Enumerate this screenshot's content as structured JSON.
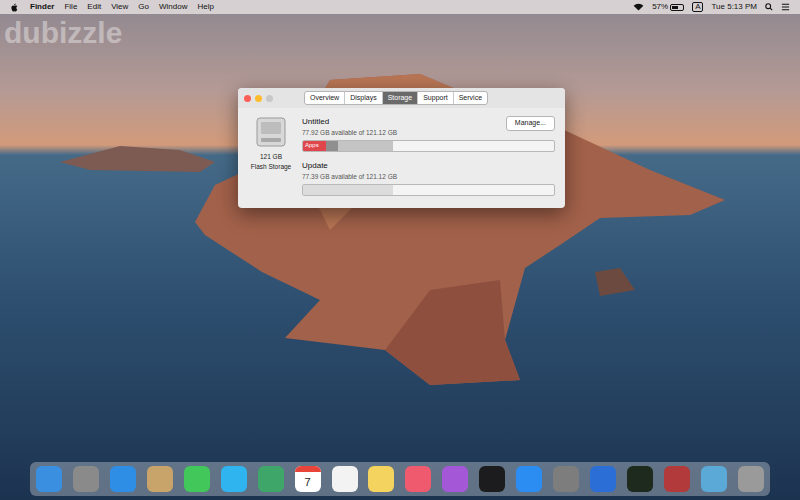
{
  "menu_bar": {
    "app": "Finder",
    "menus": [
      "File",
      "Edit",
      "View",
      "Go",
      "Window",
      "Help"
    ],
    "battery": "57%",
    "clock": "Tue 5:13 PM",
    "input_source": "A"
  },
  "watermark": "dubizzle",
  "window": {
    "tabs": [
      {
        "label": "Overview",
        "selected": false
      },
      {
        "label": "Displays",
        "selected": false
      },
      {
        "label": "Storage",
        "selected": true
      },
      {
        "label": "Support",
        "selected": false
      },
      {
        "label": "Service",
        "selected": false
      }
    ],
    "disk": {
      "capacity": "121 GB",
      "type": "Flash Storage"
    },
    "manage_button": "Manage...",
    "volumes": [
      {
        "name": "Untitled",
        "available": "77.92 GB available of 121.12 GB",
        "manage": true,
        "segments": [
          {
            "label": "Apps",
            "level": 0.09,
            "color": "#e0474c"
          },
          {
            "level": 0.05,
            "color": "#8f8f8f"
          },
          {
            "level": 0.22,
            "color": "#c4c4c4"
          }
        ]
      },
      {
        "name": "Update",
        "available": "77.39 GB available of 121.12 GB",
        "manage": false,
        "segments": [
          {
            "level": 0.36,
            "color": "#dcdcdc"
          }
        ]
      }
    ]
  },
  "dock": {
    "calendar_day": "7"
  }
}
